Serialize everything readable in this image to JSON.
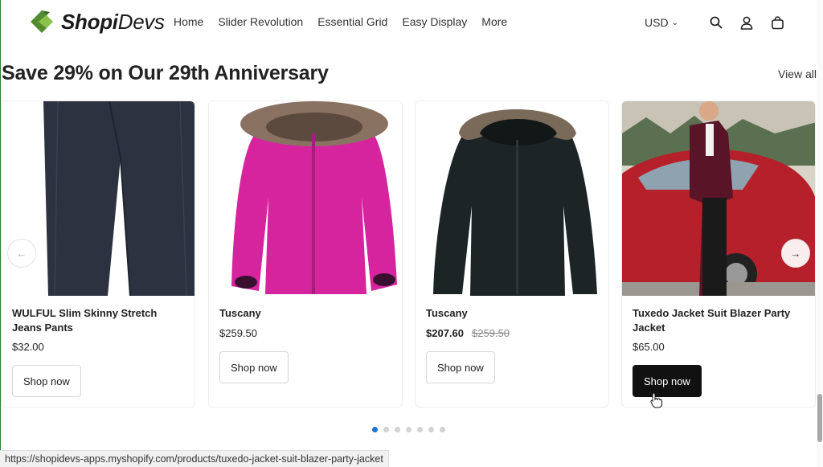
{
  "header": {
    "brand_bold": "Shopi",
    "brand_light": "Devs",
    "nav": [
      "Home",
      "Slider Revolution",
      "Essential Grid",
      "Easy Display",
      "More"
    ],
    "currency": "USD",
    "icons": [
      "search-icon",
      "account-icon",
      "cart-icon"
    ]
  },
  "section": {
    "title": "Save 29% on Our 29th Anniversary",
    "view_all": "View all"
  },
  "products": [
    {
      "name": "WULFUL Slim Skinny Stretch Jeans Pants",
      "price": "$32.00",
      "compare_price": "",
      "button": "Shop now"
    },
    {
      "name": "Tuscany",
      "price": "$259.50",
      "compare_price": "",
      "button": "Shop now"
    },
    {
      "name": "Tuscany",
      "price": "$207.60",
      "compare_price": "$259.50",
      "button": "Shop now"
    },
    {
      "name": "Tuxedo Jacket Suit Blazer Party Jacket",
      "price": "$65.00",
      "compare_price": "",
      "button": "Shop now"
    }
  ],
  "carousel": {
    "prev": "←",
    "next": "→",
    "dot_count": 7,
    "active_dot": 1
  },
  "status_url": "https://shopidevs-apps.myshopify.com/products/tuxedo-jacket-suit-blazer-party-jacket",
  "colors": {
    "accent": "#1976d2",
    "logo_green": "#7cb342",
    "button_dark": "#111111"
  }
}
